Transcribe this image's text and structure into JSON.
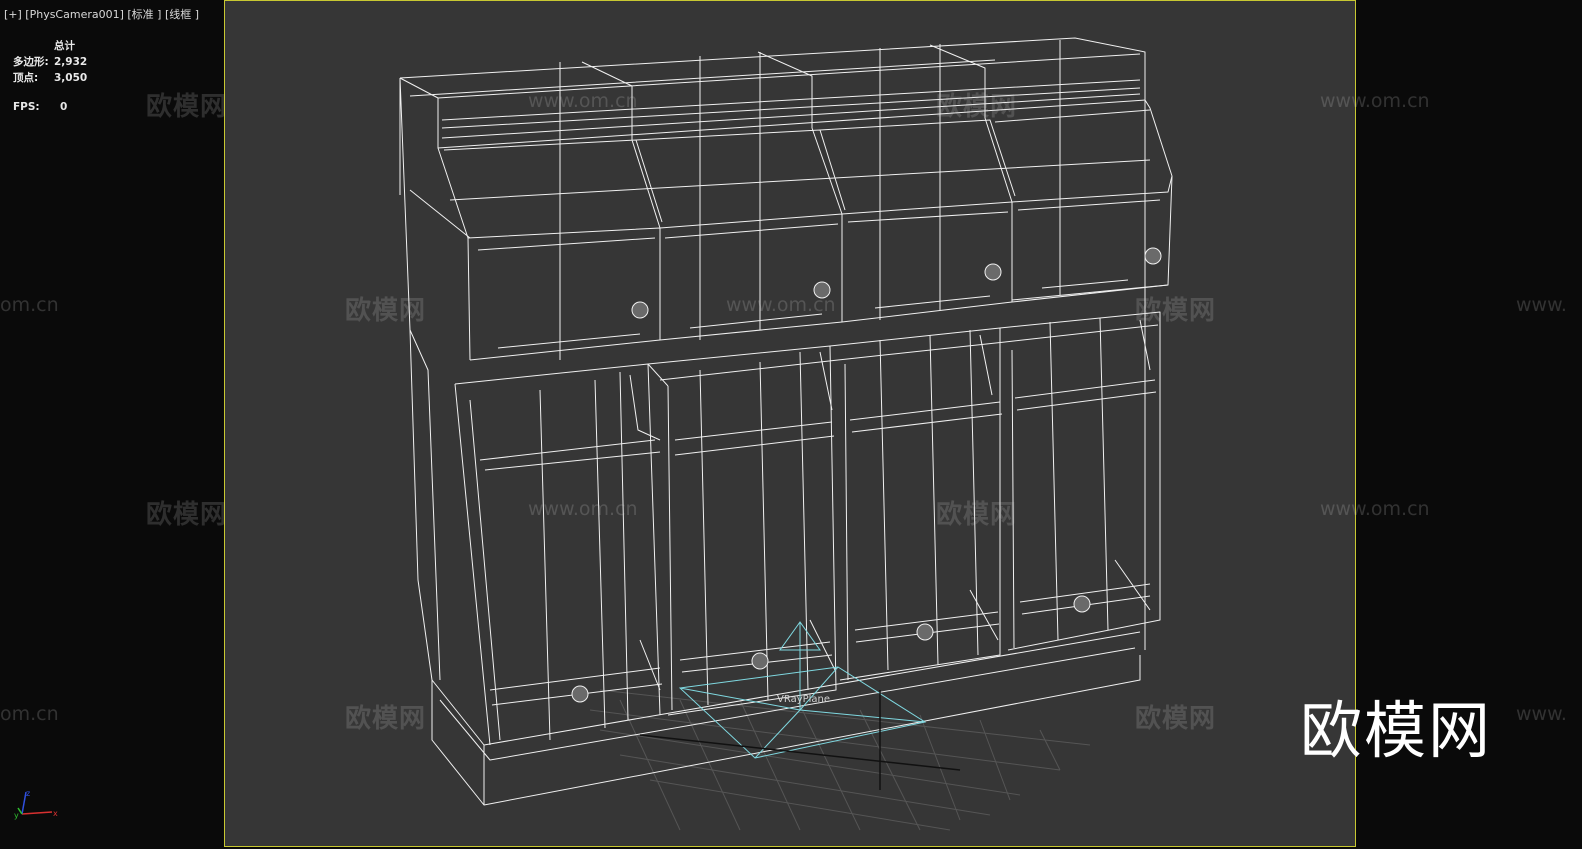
{
  "viewport": {
    "label": "[+] [PhysCamera001] [标准 ] [线框 ]",
    "frame_color": "#c8c832",
    "background": "#363636"
  },
  "stats": {
    "header": "总计",
    "polygons_label": "多边形:",
    "polygons_value": "2,932",
    "vertices_label": "顶点:",
    "vertices_value": "3,050",
    "fps_label": "FPS:",
    "fps_value": "0"
  },
  "scene": {
    "object_label": "VRayPlane",
    "wire_color": "#ffffff",
    "plane_color": "#7fd8e0",
    "grid_color": "#555555"
  },
  "watermark": {
    "text": "欧模网",
    "url": "www.om.cn",
    "url_short": "om.cn",
    "url_prefix": "www."
  },
  "logo": {
    "text": "欧模网"
  },
  "axis_icon": {
    "x": "x",
    "y": "y",
    "z": "z"
  }
}
